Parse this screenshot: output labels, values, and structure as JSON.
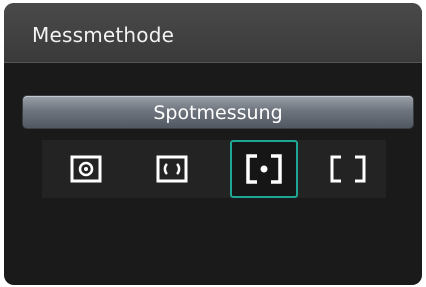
{
  "header": {
    "title": "Messmethode"
  },
  "selected_mode": {
    "label": "Spotmessung"
  },
  "metering_options": [
    {
      "icon": "evaluative-metering-icon",
      "selected": false
    },
    {
      "icon": "partial-metering-icon",
      "selected": false
    },
    {
      "icon": "spot-metering-icon",
      "selected": true
    },
    {
      "icon": "center-weighted-metering-icon",
      "selected": false
    }
  ],
  "colors": {
    "selection_border": "#1fa594",
    "icon": "#ffffff",
    "background": "#1a1a1a"
  }
}
